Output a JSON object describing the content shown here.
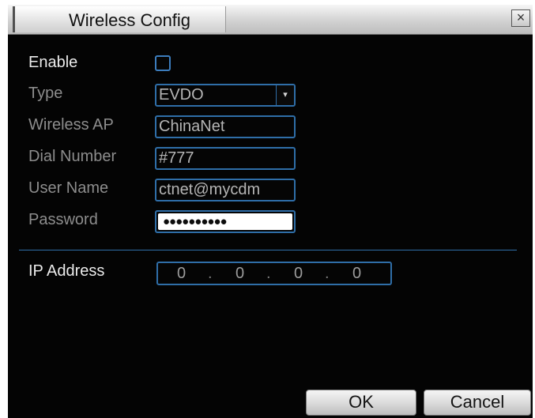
{
  "window": {
    "title": "Wireless Config",
    "close_glyph": "×"
  },
  "form": {
    "enable": {
      "label": "Enable",
      "checked": false
    },
    "type": {
      "label": "Type",
      "value": "EVDO",
      "dropdown_glyph": "▾"
    },
    "wireless_ap": {
      "label": "Wireless AP",
      "value": "ChinaNet"
    },
    "dial_number": {
      "label": "Dial Number",
      "value": "#777"
    },
    "user_name": {
      "label": "User Name",
      "value": "ctnet@mycdm"
    },
    "password": {
      "label": "Password",
      "masked_value": "●●●●●●●●●●"
    },
    "ip_address": {
      "label": "IP Address",
      "octets": [
        "0",
        "0",
        "0",
        "0"
      ],
      "separator": "."
    }
  },
  "buttons": {
    "ok": "OK",
    "cancel": "Cancel"
  },
  "colors": {
    "dialog_background": "#040404",
    "field_border": "#2f6ea8",
    "title_bar": "#d2d2d2"
  },
  "icons": {
    "close": "close-icon",
    "dropdown": "chevron-down-icon"
  }
}
